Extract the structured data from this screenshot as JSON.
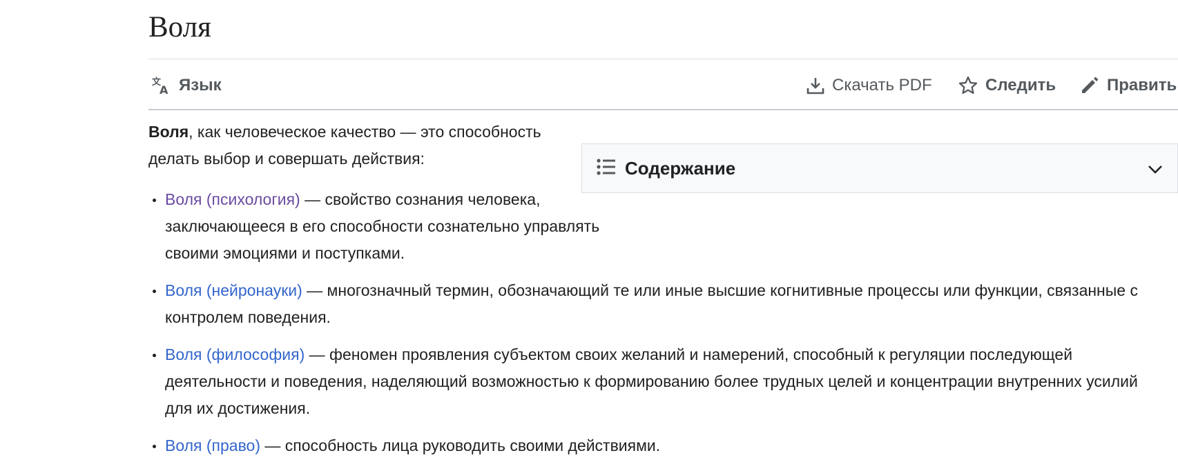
{
  "page": {
    "title": "Воля"
  },
  "toolbar": {
    "language_label": "Язык",
    "language_icon": "translate-icon",
    "download_label": "Скачать PDF",
    "download_icon": "download-icon",
    "watch_label": "Следить",
    "watch_icon": "star-icon",
    "edit_label": "Править",
    "edit_icon": "pencil-icon"
  },
  "toc": {
    "title": "Содержание",
    "icon": "list-icon",
    "toggle_icon": "chevron-down-icon"
  },
  "intro": {
    "bold_term": "Воля",
    "text": ", как человеческое качество — это способность делать выбор и совершать действия:"
  },
  "items": [
    {
      "link": "Воля (психология)",
      "visited": true,
      "text": " — свойство сознания человека, заключающееся в его способности сознательно управлять своими эмоциями и поступками."
    },
    {
      "link": "Воля (нейронауки)",
      "visited": false,
      "text": " — многозначный термин, обозначающий те или иные высшие когнитивные процессы или функции, связанные с контролем поведения."
    },
    {
      "link": "Воля (философия)",
      "visited": false,
      "text": " — феномен проявления субъектом своих желаний и намерений, способный к регуляции последующей деятельности и поведения, наделяющий возможностью к формированию более трудных целей и концентрации внутренних усилий для их достижения."
    },
    {
      "link": "Воля (право)",
      "visited": false,
      "text": " — способность лица руководить своими действиями."
    }
  ],
  "colors": {
    "link": "#3366cc",
    "visited_link": "#6b4ba1",
    "text": "#202122",
    "muted": "#54595d",
    "toc_background": "#f8f9fa"
  }
}
